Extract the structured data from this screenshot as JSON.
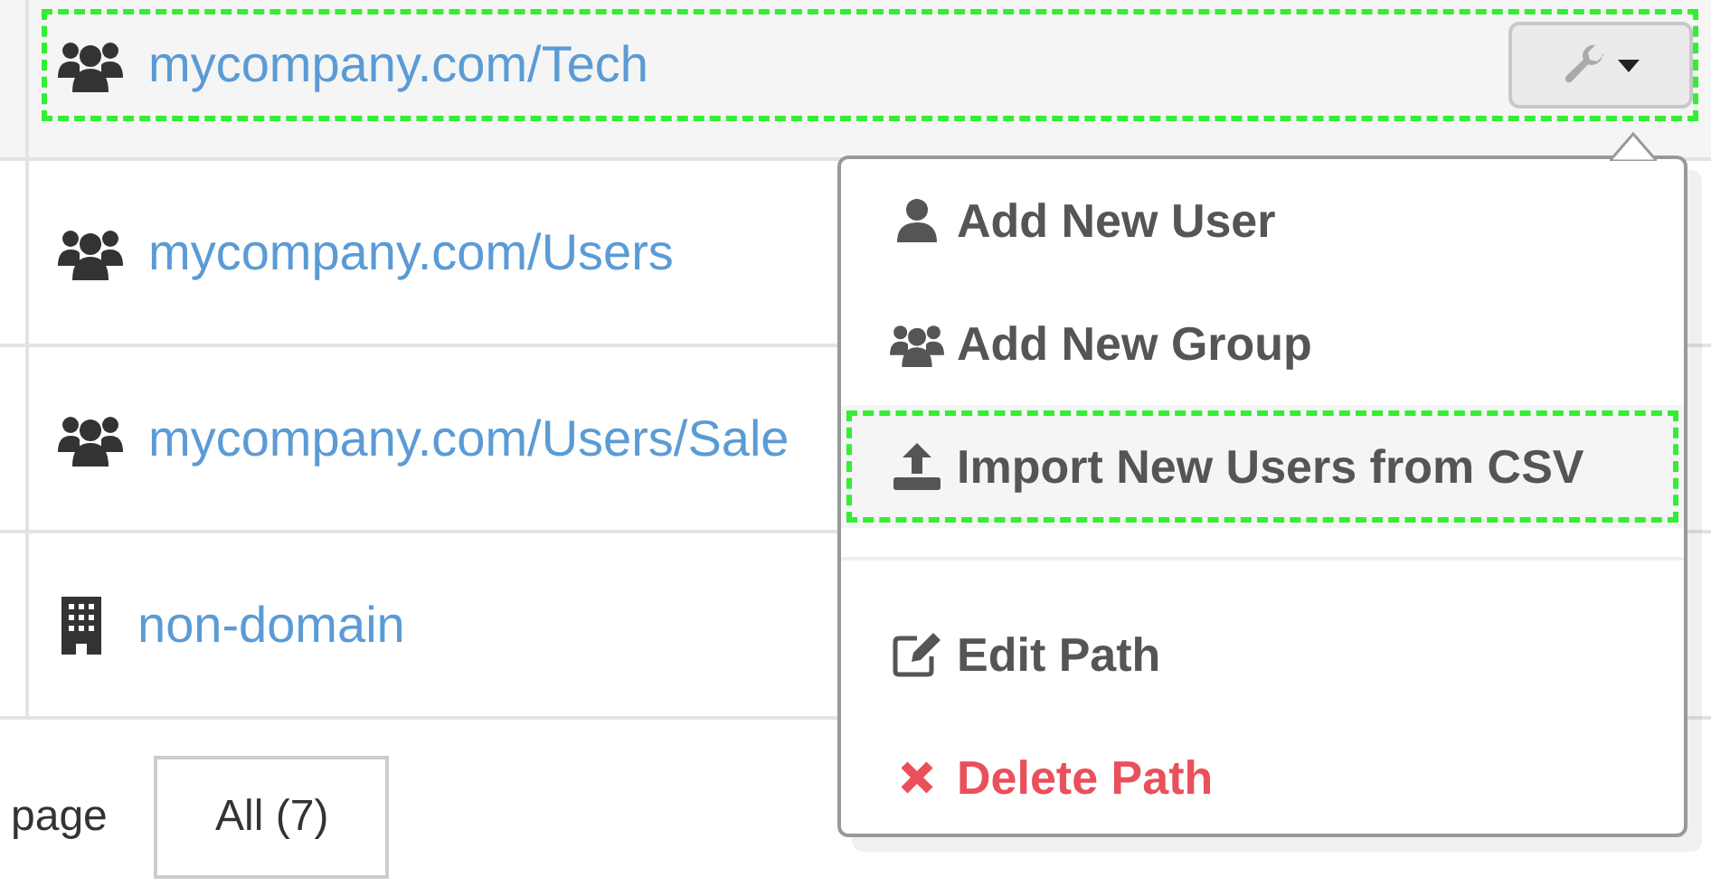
{
  "rows": [
    {
      "kind": "group",
      "label": "mycompany.com/Tech",
      "hovered": true,
      "highlighted": true,
      "has_tools": true
    },
    {
      "kind": "group",
      "label": "mycompany.com/Users",
      "hovered": false,
      "highlighted": false,
      "has_tools": false
    },
    {
      "kind": "group",
      "label": "mycompany.com/Users/Sale",
      "hovered": false,
      "highlighted": false,
      "has_tools": false
    },
    {
      "kind": "building",
      "label": "non-domain",
      "hovered": false,
      "highlighted": false,
      "has_tools": false
    }
  ],
  "menu": {
    "items": [
      {
        "kind": "user",
        "label": "Add New User",
        "danger": false,
        "highlighted": false
      },
      {
        "kind": "group",
        "label": "Add New Group",
        "danger": false,
        "highlighted": false
      },
      {
        "kind": "upload",
        "label": "Import New Users from CSV",
        "danger": false,
        "highlighted": true
      },
      {
        "kind": "divider"
      },
      {
        "kind": "edit",
        "label": "Edit Path",
        "danger": false,
        "highlighted": false
      },
      {
        "kind": "delete",
        "label": "Delete Path",
        "danger": true,
        "highlighted": false
      }
    ]
  },
  "pagination": {
    "label": "page",
    "button": "All (7)"
  }
}
